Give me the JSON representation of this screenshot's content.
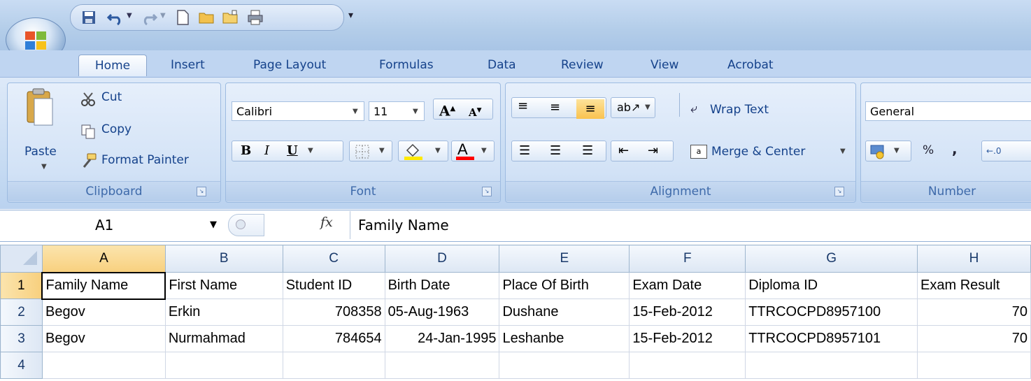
{
  "tabs": [
    "Home",
    "Insert",
    "Page Layout",
    "Formulas",
    "Data",
    "Review",
    "View",
    "Acrobat"
  ],
  "clipboard": {
    "paste": "Paste",
    "cut": "Cut",
    "copy": "Copy",
    "format_painter": "Format Painter",
    "label": "Clipboard"
  },
  "font": {
    "name": "Calibri",
    "size": "11",
    "bold": "B",
    "italic": "I",
    "underline": "U",
    "label": "Font"
  },
  "alignment": {
    "wrap": "Wrap Text",
    "merge": "Merge & Center",
    "label": "Alignment"
  },
  "number": {
    "format": "General",
    "percent": "%",
    "comma": ",",
    "label": "Number"
  },
  "formula_bar": {
    "cell": "A1",
    "fx": "fx",
    "content": "Family Name"
  },
  "grid": {
    "columns": [
      "A",
      "B",
      "C",
      "D",
      "E",
      "F",
      "G",
      "H"
    ],
    "rows": [
      {
        "num": "1",
        "cells": [
          "Family Name",
          "First Name",
          "Student ID",
          "Birth Date",
          "Place Of Birth",
          "Exam Date",
          "Diploma ID",
          "Exam Result"
        ]
      },
      {
        "num": "2",
        "cells": [
          "Begov",
          "Erkin",
          "708358",
          "05-Aug-1963",
          "Dushane",
          "15-Feb-2012",
          "TTRCOCPD8957100",
          "70"
        ]
      },
      {
        "num": "3",
        "cells": [
          "Begov",
          "Nurmahmad",
          "784654",
          "24-Jan-1995",
          "Leshanbe",
          "15-Feb-2012",
          "TTRCOCPD8957101",
          "70"
        ]
      },
      {
        "num": "4",
        "cells": [
          "",
          "",
          "",
          "",
          "",
          "",
          "",
          ""
        ]
      }
    ]
  },
  "colors": {
    "accent": "#15428b",
    "ribbon": "#c5daf2",
    "selected_header": "#f8d07e"
  }
}
